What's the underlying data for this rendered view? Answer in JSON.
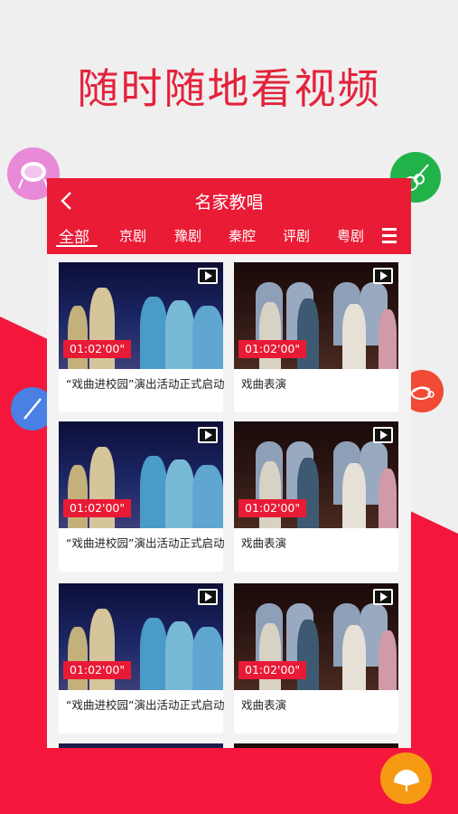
{
  "headline": "随时随地看视频",
  "app": {
    "title": "名家教唱",
    "tabs": [
      "全部",
      "京剧",
      "豫剧",
      "秦腔",
      "评剧",
      "粤剧"
    ]
  },
  "videos": [
    {
      "caption": "“戏曲进校园”演出活动正式启动",
      "duration": "01:02'00\""
    },
    {
      "caption": "戏曲表演",
      "duration": "01:02'00\""
    },
    {
      "caption": "“戏曲进校园”演出活动正式启动",
      "duration": "01:02'00\""
    },
    {
      "caption": "戏曲表演",
      "duration": "01:02'00\""
    },
    {
      "caption": "“戏曲进校园”演出活动正式启动",
      "duration": "01:02'00\""
    },
    {
      "caption": "戏曲表演",
      "duration": "01:02'00\""
    }
  ],
  "decor_icons": [
    "drum-icon",
    "guitar-icon",
    "flute-icon",
    "gong-icon",
    "fan-icon"
  ],
  "colors": {
    "accent": "#ea1b35",
    "background": "#efefef"
  }
}
